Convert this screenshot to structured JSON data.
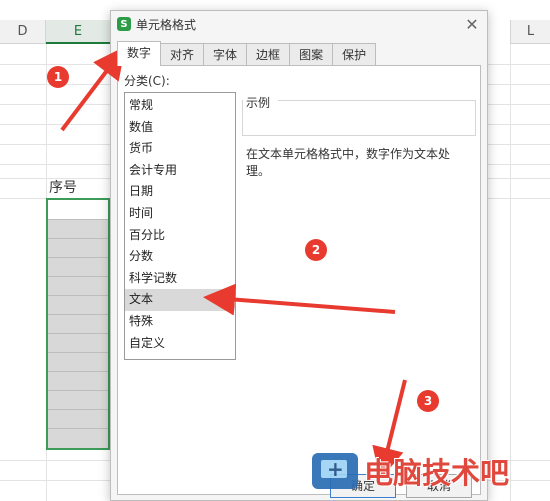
{
  "sheet": {
    "col_d": "D",
    "col_e": "E",
    "col_l": "L",
    "header_cell": "序号"
  },
  "dialog": {
    "title": "单元格格式",
    "app_icon_letter": "S",
    "tabs": [
      "数字",
      "对齐",
      "字体",
      "边框",
      "图案",
      "保护"
    ],
    "category_label": "分类(C):",
    "categories": [
      "常规",
      "数值",
      "货币",
      "会计专用",
      "日期",
      "时间",
      "百分比",
      "分数",
      "科学记数",
      "文本",
      "特殊",
      "自定义"
    ],
    "selected_category": "文本",
    "sample_label": "示例",
    "description": "在文本单元格格式中，数字作为文本处理。",
    "ok_label": "确定",
    "cancel_label": "取消"
  },
  "annotations": {
    "step1": "1",
    "step2": "2",
    "step3": "3",
    "arrow_color": "#e83a2e"
  },
  "watermark": {
    "text": "电脑技术吧"
  }
}
